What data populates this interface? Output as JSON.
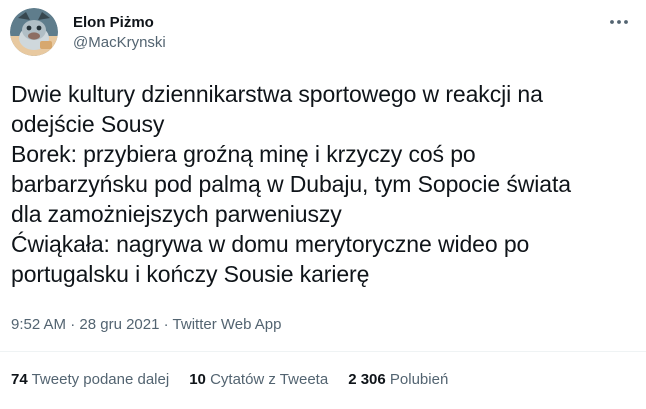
{
  "author": {
    "display_name": "Elon Piżmo",
    "handle": "@MacKrynski"
  },
  "tweet": {
    "lines": [
      "Dwie kultury dziennikarstwa sportowego w reakcji na",
      "odejście Sousy",
      "Borek: przybiera groźną minę i krzyczy coś po",
      "barbarzyńsku pod palmą w Dubaju, tym Sopocie świata",
      "dla zamożniejszych parweniuszy",
      "Ćwiąkała: nagrywa w domu merytoryczne wideo po",
      "portugalsku i kończy Sousie karierę"
    ]
  },
  "meta": {
    "time": "9:52 AM",
    "sep": "·",
    "date": "28 gru 2021",
    "source": "Twitter Web App"
  },
  "stats": {
    "retweets_count": "74",
    "retweets_label": "Tweety podane dalej",
    "quotes_count": "10",
    "quotes_label": "Cytatów z Tweeta",
    "likes_count": "2 306",
    "likes_label": "Polubień"
  },
  "icons": {
    "more": "more-horizontal-icon",
    "avatar": "avatar"
  },
  "colors": {
    "text": "#0f1419",
    "secondary": "#536471",
    "divider": "#eff3f4"
  }
}
